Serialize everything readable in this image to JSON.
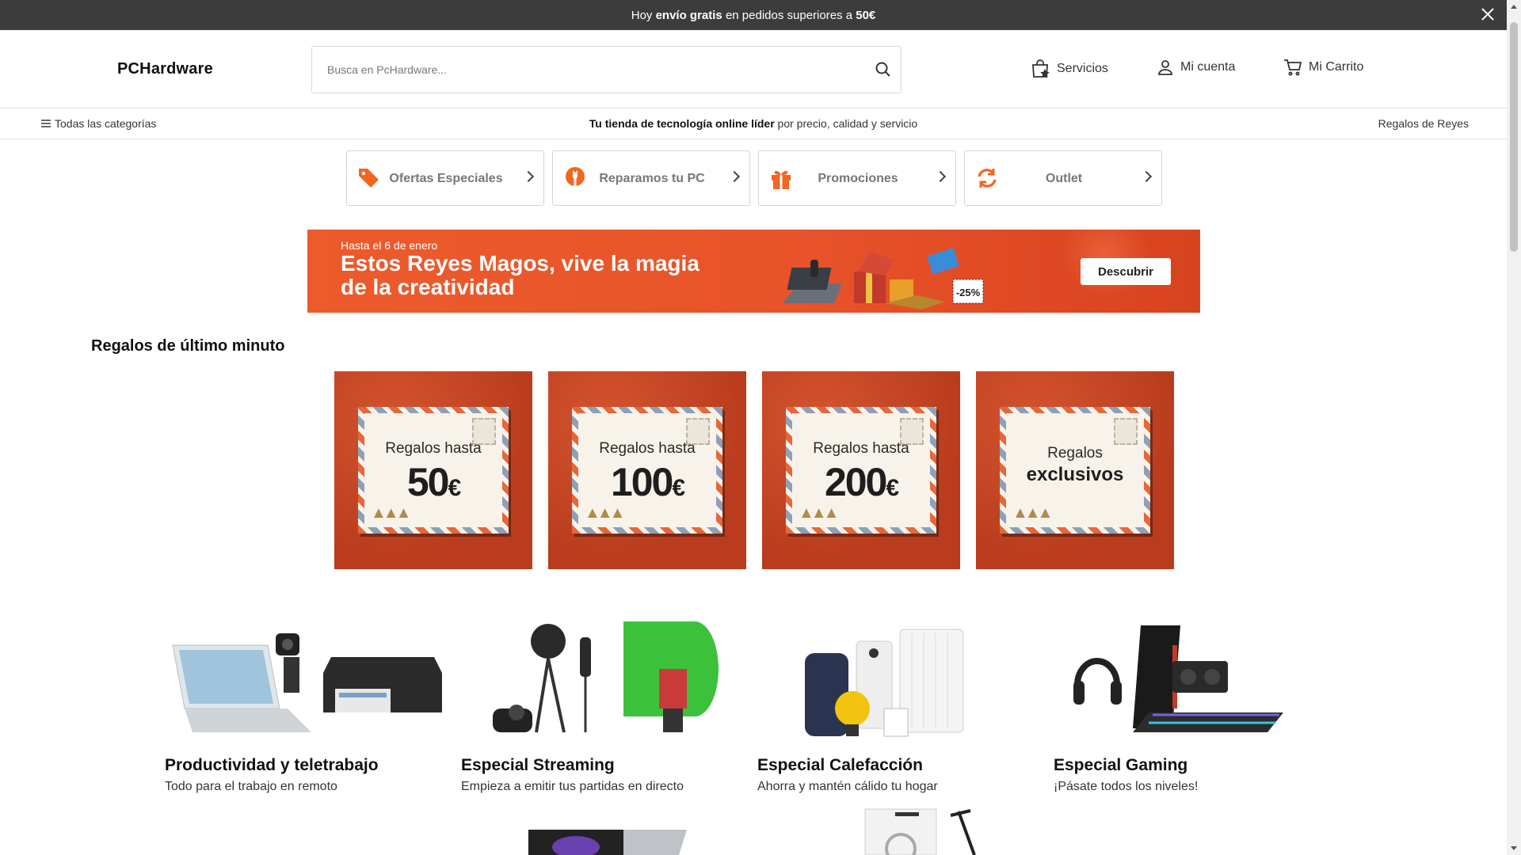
{
  "topbar": {
    "prefix": "Hoy ",
    "highlight": "envío gratis",
    "middle": " en pedidos superiores a ",
    "amount": "50€"
  },
  "header": {
    "logo": "PCHardware",
    "search_placeholder": "Busca en PcHardware...",
    "services": "Servicios",
    "account": "Mi cuenta",
    "cart": "Mi Carrito"
  },
  "subnav": {
    "categories": "Todas las categorías",
    "tagline_bold": "Tu tienda de tecnología online líder",
    "tagline_rest": " por precio, calidad y servicio",
    "right_link": "Regalos de Reyes"
  },
  "quick_links": [
    {
      "label": "Ofertas Especiales",
      "icon": "price-tag-icon"
    },
    {
      "label": "Reparamos tu PC",
      "icon": "wrench-icon"
    },
    {
      "label": "Promociones",
      "icon": "gift-icon"
    },
    {
      "label": "Outlet",
      "icon": "refresh-icon"
    }
  ],
  "banner": {
    "small": "Hasta el 6 de enero",
    "line1": "Estos Reyes Magos, vive la magia",
    "line2": "de la creatividad",
    "discount": "-25%",
    "button": "Descubrir"
  },
  "gifts_section": {
    "title": "Regalos de último minuto",
    "cards": [
      {
        "line1": "Regalos hasta",
        "amount": "50",
        "currency": "€"
      },
      {
        "line1": "Regalos hasta",
        "amount": "100",
        "currency": "€"
      },
      {
        "line1": "Regalos hasta",
        "amount": "200",
        "currency": "€"
      },
      {
        "line1": "Regalos",
        "line2": "exclusivos"
      }
    ]
  },
  "categories": [
    {
      "title": "Productividad y teletrabajo",
      "subtitle": "Todo para el trabajo en remoto"
    },
    {
      "title": "Especial Streaming",
      "subtitle": "Empieza a emitir tus partidas en directo"
    },
    {
      "title": "Especial Calefacción",
      "subtitle": "Ahorra y mantén cálido tu hogar"
    },
    {
      "title": "Especial Gaming",
      "subtitle": "¡Pásate todos los niveles!"
    }
  ],
  "colors": {
    "accent": "#f26522",
    "banner": "#e8532a",
    "topbar": "#3c3c3c"
  }
}
